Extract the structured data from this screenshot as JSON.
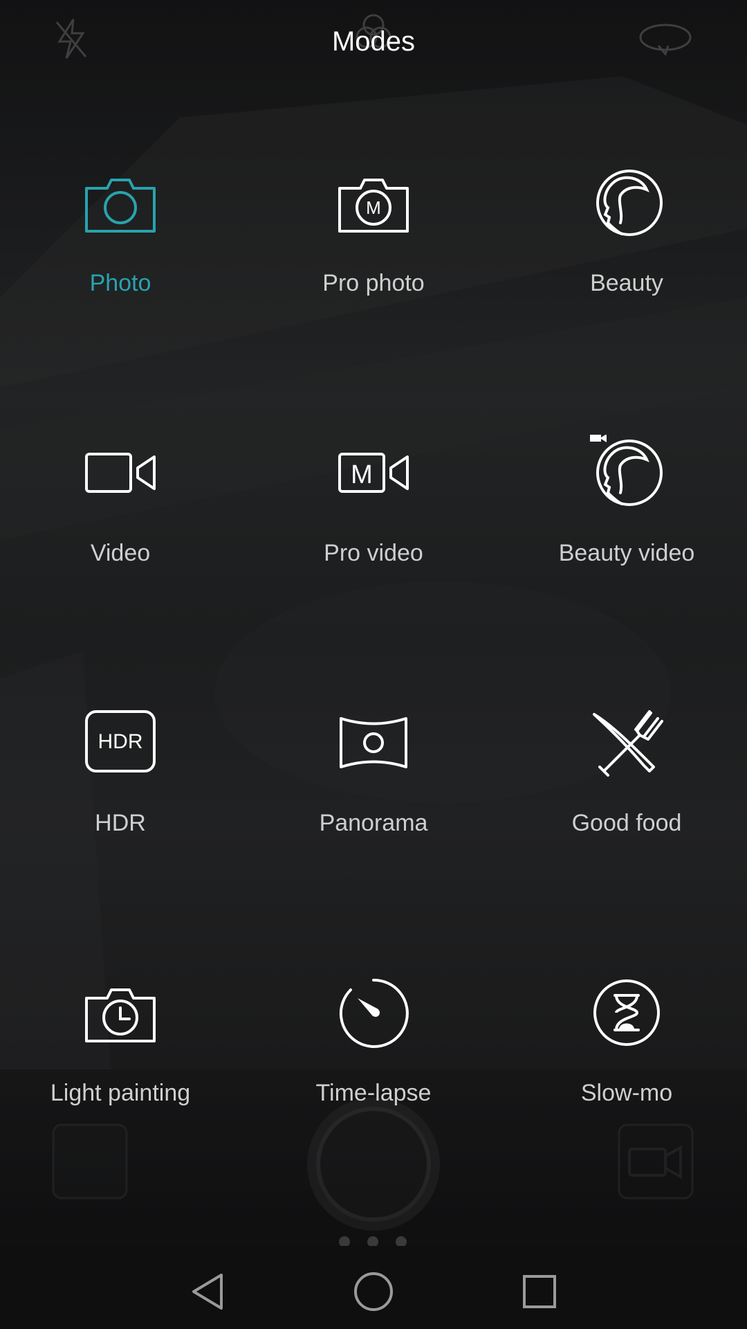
{
  "header": {
    "title": "Modes"
  },
  "modes": [
    {
      "label": "Photo",
      "icon": "camera-icon",
      "active": true
    },
    {
      "label": "Pro photo",
      "icon": "pro-camera-icon",
      "active": false
    },
    {
      "label": "Beauty",
      "icon": "beauty-face-icon",
      "active": false
    },
    {
      "label": "Video",
      "icon": "video-camera-icon",
      "active": false
    },
    {
      "label": "Pro video",
      "icon": "pro-video-icon",
      "active": false
    },
    {
      "label": "Beauty video",
      "icon": "beauty-video-icon",
      "active": false
    },
    {
      "label": "HDR",
      "icon": "hdr-icon",
      "active": false
    },
    {
      "label": "Panorama",
      "icon": "panorama-icon",
      "active": false
    },
    {
      "label": "Good food",
      "icon": "food-icon",
      "active": false
    },
    {
      "label": "Light painting",
      "icon": "light-painting-icon",
      "active": false
    },
    {
      "label": "Time-lapse",
      "icon": "timelapse-icon",
      "active": false
    },
    {
      "label": "Slow-mo",
      "icon": "slow-mo-icon",
      "active": false
    }
  ],
  "icons": {
    "hdr_text": "HDR",
    "pro_badge": "M"
  },
  "colors": {
    "accent": "#28a3ad",
    "label": "#cfcfcf",
    "title": "#ffffff"
  },
  "nav": {
    "back": "back-icon",
    "home": "home-icon",
    "recents": "recents-icon"
  }
}
